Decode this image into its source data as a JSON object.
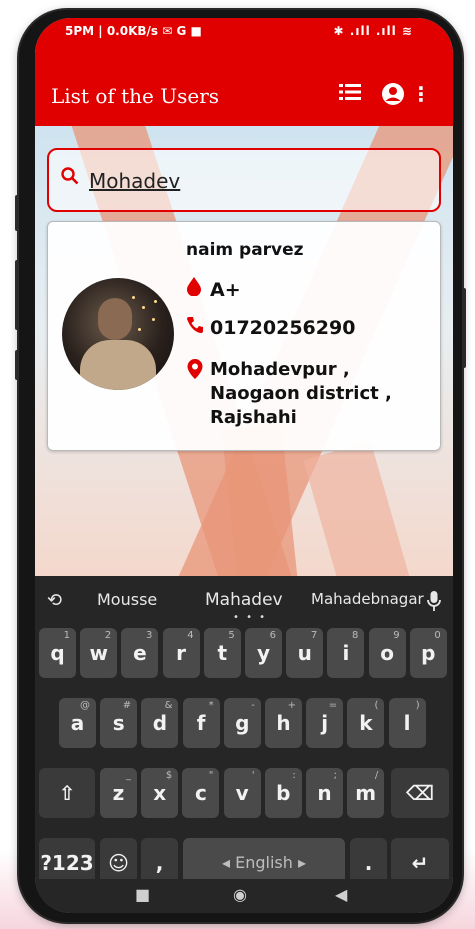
{
  "status_bar": {
    "left": "5PM | 0.0KB/s ✉ G ■",
    "right": "✱ .ıll .ıll ≋"
  },
  "appbar": {
    "title": "List of the Users",
    "list_icon": "list-icon",
    "account_icon": "account-circle-icon",
    "more_icon": "more-vert-icon"
  },
  "search": {
    "value": "Mohadev",
    "icon": "search-icon"
  },
  "user": {
    "name": "naim parvez",
    "blood_group": "A+",
    "phone": "01720256290",
    "address": "Mohadevpur , Naogaon district , Rajshahi"
  },
  "keyboard": {
    "suggestions": [
      "Mousse",
      "Mahadev",
      "Mahadebnagar"
    ],
    "row1": [
      [
        "q",
        "1"
      ],
      [
        "w",
        "2"
      ],
      [
        "e",
        "3"
      ],
      [
        "r",
        "4"
      ],
      [
        "t",
        "5"
      ],
      [
        "y",
        "6"
      ],
      [
        "u",
        "7"
      ],
      [
        "i",
        "8"
      ],
      [
        "o",
        "9"
      ],
      [
        "p",
        "0"
      ]
    ],
    "row2": [
      [
        "a",
        "@"
      ],
      [
        "s",
        "#"
      ],
      [
        "d",
        "&"
      ],
      [
        "f",
        "*"
      ],
      [
        "g",
        "-"
      ],
      [
        "h",
        "+"
      ],
      [
        "j",
        "="
      ],
      [
        "k",
        "("
      ],
      [
        "l",
        ")"
      ]
    ],
    "row3": [
      [
        "z",
        "_"
      ],
      [
        "x",
        "$"
      ],
      [
        "c",
        "\""
      ],
      [
        "v",
        "'"
      ],
      [
        "b",
        ":"
      ],
      [
        "n",
        ";"
      ],
      [
        "m",
        "/"
      ]
    ],
    "shift": "⇧",
    "backspace": "⌫",
    "symbols": "?123",
    "emoji": "☺",
    "comma": ",",
    "space": "◂ English ▸",
    "period": ".",
    "enter": "↵"
  },
  "navbar": {
    "back": "■",
    "home": "◉",
    "recents": "◀"
  },
  "colors": {
    "primary": "#e00000",
    "keyboard_bg": "#262626",
    "key_bg": "#4a4a4a"
  }
}
